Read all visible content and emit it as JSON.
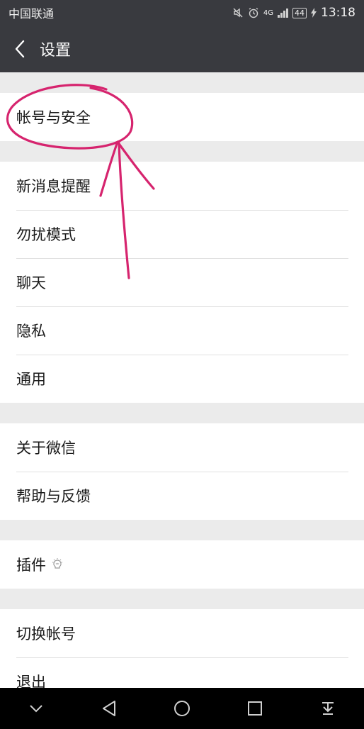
{
  "status_bar": {
    "carrier": "中国联通",
    "network": "4G",
    "battery": "44",
    "time": "13:18"
  },
  "nav": {
    "title": "设置",
    "back_icon": "chevron-left-icon"
  },
  "groups": [
    {
      "items": [
        {
          "label": "帐号与安全"
        }
      ]
    },
    {
      "items": [
        {
          "label": "新消息提醒"
        },
        {
          "label": "勿扰模式"
        },
        {
          "label": "聊天"
        },
        {
          "label": "隐私"
        },
        {
          "label": "通用"
        }
      ]
    },
    {
      "items": [
        {
          "label": "关于微信"
        },
        {
          "label": "帮助与反馈"
        }
      ]
    },
    {
      "items": [
        {
          "label": "插件",
          "icon": "lightbulb-icon"
        }
      ]
    },
    {
      "items": [
        {
          "label": "切换帐号"
        },
        {
          "label": "退出"
        }
      ]
    }
  ],
  "annotation": {
    "color": "#d6246e"
  },
  "colors": {
    "bar": "#393a3f",
    "background": "#ebebeb"
  }
}
